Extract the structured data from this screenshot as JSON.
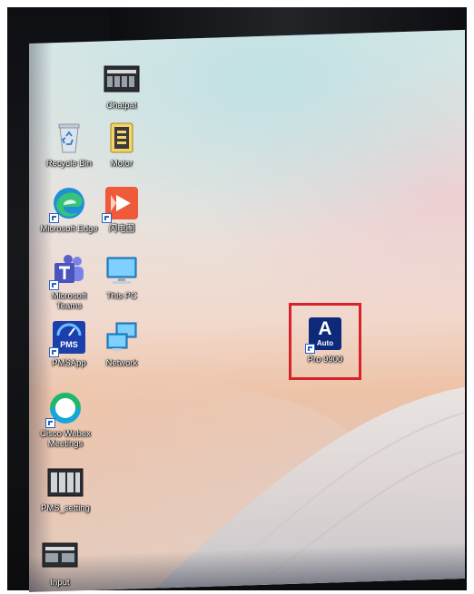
{
  "desktop": {
    "icons": [
      {
        "id": "chatpat",
        "label": "Chatpat"
      },
      {
        "id": "recycle-bin",
        "label": "Recycle Bin"
      },
      {
        "id": "motor",
        "label": "Motor"
      },
      {
        "id": "microsoft-edge",
        "label": "Microsoft Edge"
      },
      {
        "id": "app-cn",
        "label": "闪电图"
      },
      {
        "id": "microsoft-teams",
        "label": "Microsoft Teams"
      },
      {
        "id": "this-pc",
        "label": "This PC"
      },
      {
        "id": "pmsapp",
        "label": "PMSApp"
      },
      {
        "id": "network",
        "label": "Network"
      },
      {
        "id": "cisco-webex",
        "label": "Cisco Webex Meetings"
      },
      {
        "id": "pms-setting",
        "label": "PMS_setting"
      },
      {
        "id": "input",
        "label": "Input"
      },
      {
        "id": "pro-9900",
        "label": "Pro 9900",
        "glyph_text": "A",
        "glyph_subtext": "Auto"
      }
    ],
    "pms_glyph_text": "PMS"
  },
  "colors": {
    "highlight": "#d8222a",
    "edge": "#1f8fd6",
    "teams": "#5b5fc7",
    "pro_app": "#0d2a7a"
  }
}
